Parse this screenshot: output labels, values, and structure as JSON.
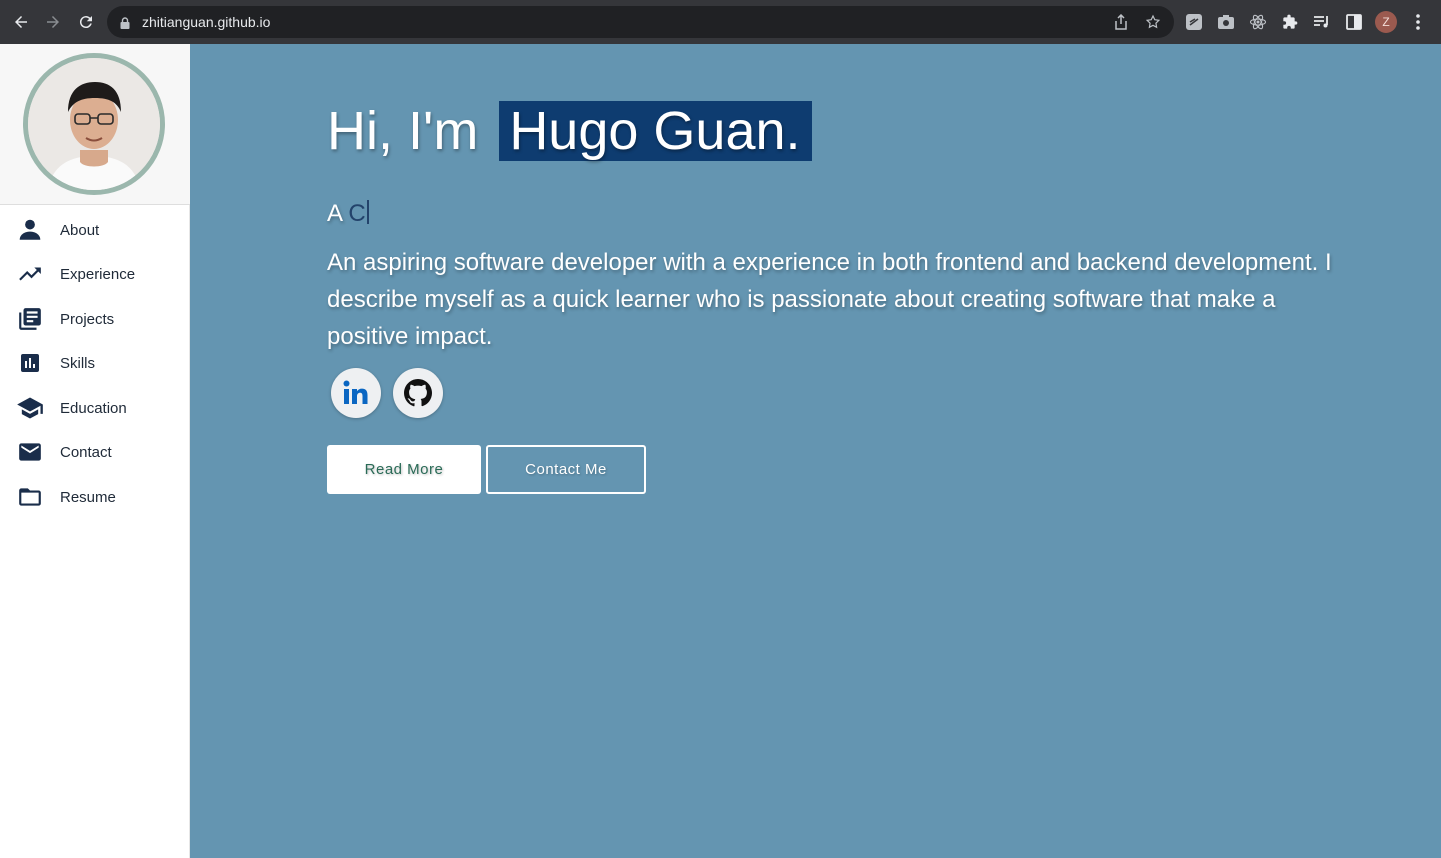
{
  "browser": {
    "url": "zhitianguan.github.io",
    "profile_initial": "Z",
    "icons": [
      "back-icon",
      "forward-icon",
      "reload-icon",
      "lock-icon",
      "share-icon",
      "bookmark-star-icon",
      "extension-icon",
      "camera-extension-icon",
      "react-devtools-icon",
      "puzzle-icon",
      "media-queue-icon",
      "side-panel-icon",
      "menu-dots-icon"
    ]
  },
  "sidebar": {
    "items": [
      {
        "label": "About",
        "icon": "person-icon"
      },
      {
        "label": "Experience",
        "icon": "trending-up-icon"
      },
      {
        "label": "Projects",
        "icon": "library-books-icon"
      },
      {
        "label": "Skills",
        "icon": "bar-chart-icon"
      },
      {
        "label": "Education",
        "icon": "graduation-cap-icon"
      },
      {
        "label": "Contact",
        "icon": "mail-icon"
      },
      {
        "label": "Resume",
        "icon": "folder-icon"
      }
    ]
  },
  "hero": {
    "greeting": "Hi, I'm",
    "name": "Hugo Guan.",
    "typed_prefix": "A ",
    "typed_text": "C",
    "bio": "An aspiring software developer with a experience in both frontend and backend development. I describe myself as a quick learner who is passionate about creating software that make a positive impact.",
    "social": [
      "linkedin-icon",
      "github-icon"
    ],
    "buttons": {
      "read_more": "Read More",
      "contact": "Contact Me"
    }
  },
  "colors": {
    "main_bg": "#6495b1",
    "name_highlight": "#0e3c70",
    "nav_icon": "#1a2d4a",
    "avatar_ring": "#9bb7ad"
  }
}
